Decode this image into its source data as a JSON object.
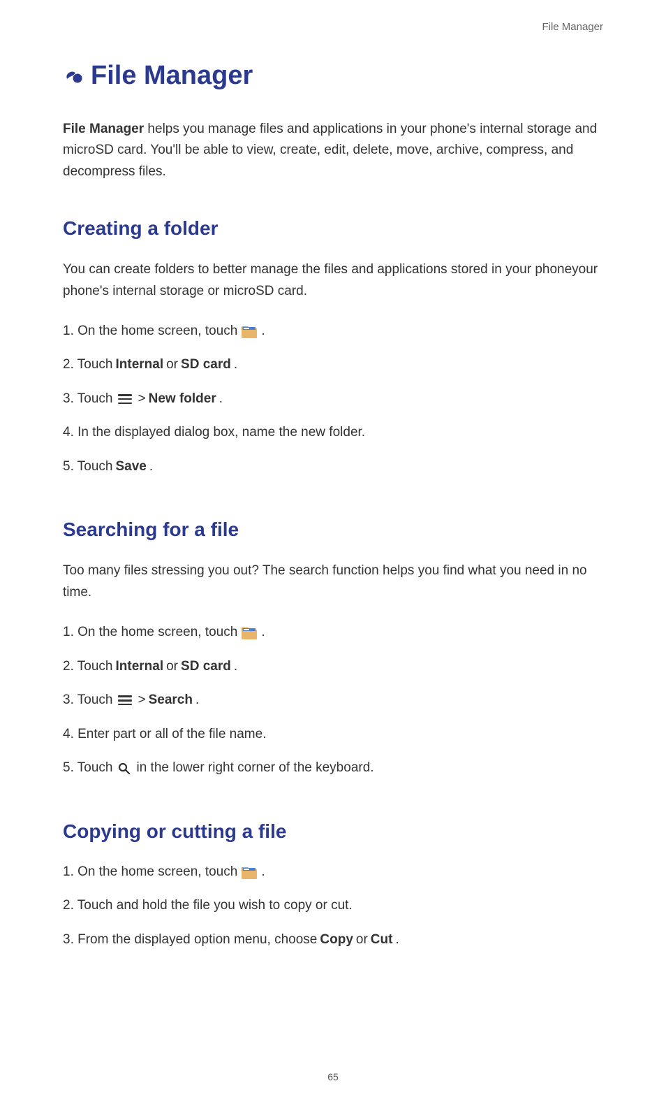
{
  "header": "File Manager",
  "title": "File Manager",
  "intro": {
    "bold": "File Manager",
    "rest": " helps you manage files and applications in your phone's internal storage and microSD card. You'll be able to view, create, edit, delete, move, archive, compress, and decompress files."
  },
  "s1": {
    "heading": "Creating a folder",
    "intro": "You can create folders to better manage the files and applications stored in your phoneyour phone's internal storage or microSD card.",
    "step1_pre": "1. On the home screen, touch ",
    "step1_post": " .",
    "step2_pre": "2. Touch ",
    "step2_b1": "Internal",
    "step2_mid": " or ",
    "step2_b2": "SD card",
    "step2_post": ".",
    "step3_pre": "3. Touch ",
    "step3_gt": " > ",
    "step3_b": "New folder",
    "step3_post": ".",
    "step4": "4. In the displayed dialog box, name the new folder.",
    "step5_pre": "5. Touch ",
    "step5_b": "Save",
    "step5_post": "."
  },
  "s2": {
    "heading": "Searching for a file",
    "intro": "Too many files stressing you out? The search function helps you find what you need in no time.",
    "step1_pre": "1. On the home screen, touch ",
    "step1_post": " .",
    "step2_pre": "2. Touch ",
    "step2_b1": "Internal",
    "step2_mid": " or ",
    "step2_b2": "SD card",
    "step2_post": ".",
    "step3_pre": "3. Touch ",
    "step3_gt": " > ",
    "step3_b": "Search",
    "step3_post": ".",
    "step4": "4. Enter part or all of the file name.",
    "step5_pre": "5. Touch ",
    "step5_post": " in the lower right corner of the keyboard."
  },
  "s3": {
    "heading": "Copying or cutting a file",
    "step1_pre": "1. On the home screen, touch ",
    "step1_post": " .",
    "step2": "2. Touch and hold the file you wish to copy or cut.",
    "step3_pre": "3. From the displayed option menu, choose ",
    "step3_b1": "Copy",
    "step3_mid": " or ",
    "step3_b2": "Cut",
    "step3_post": "."
  },
  "pageNumber": "65"
}
